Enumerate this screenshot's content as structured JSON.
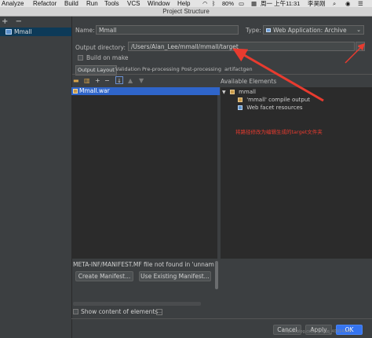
{
  "menubar": {
    "items": [
      "Analyze",
      "Refactor",
      "Build",
      "Run",
      "Tools",
      "VCS",
      "Window",
      "Help"
    ],
    "battery": "80%",
    "clock": "周一 上午11:31",
    "user": "李昊刚"
  },
  "window": {
    "title": "Project Structure"
  },
  "left_pane": {
    "add_symbol": "+",
    "remove_symbol": "−",
    "items": [
      {
        "label": "Mmall",
        "selected": true
      }
    ]
  },
  "form": {
    "name_label": "Name:",
    "name_value": "Mmall",
    "type_label": "Type:",
    "type_value": "Web Application: Archive",
    "output_dir_label": "Output directory:",
    "output_dir_value": "/Users/Alan_Lee/mmall/mmall/target",
    "build_on_make_label": "Build on make",
    "build_on_make_checked": false
  },
  "tabs": [
    {
      "label": "Output Layout",
      "active": true
    },
    {
      "label": "Validation",
      "active": false
    },
    {
      "label": "Pre-processing",
      "active": false
    },
    {
      "label": "Post-processing",
      "active": false
    },
    {
      "label": "artifactgen",
      "active": false
    }
  ],
  "output_layout": {
    "toolbar_icons": [
      "folder-icon",
      "archive-icon",
      "add-icon",
      "remove-icon",
      "sort-icon",
      "move-up-icon",
      "move-down-icon"
    ],
    "root_label": "Mmall.war"
  },
  "available_elements": {
    "title": "Available Elements",
    "items": [
      {
        "label": "mmall",
        "level": 0,
        "expanded": true,
        "icon": "module-folder-icon"
      },
      {
        "label": "'mmall' compile output",
        "level": 1,
        "icon": "compile-output-icon"
      },
      {
        "label": "Web facet resources",
        "level": 1,
        "icon": "web-facet-icon"
      }
    ]
  },
  "annotation": {
    "text": "将路径修改为编辑生成的target文件夹",
    "color": "#e83b2f"
  },
  "manifest": {
    "message": "META-INF/MANIFEST.MF file not found in 'unnamed",
    "create_label": "Create Manifest...",
    "use_existing_label": "Use Existing Manifest..."
  },
  "show_content": {
    "label": "Show content of elements",
    "checked": false
  },
  "buttons": {
    "cancel": "Cancel",
    "apply": "Apply",
    "ok": "OK"
  },
  "watermark": "https://blog.csdn.net/qq_40914148",
  "colors": {
    "selection": "#2f65ca",
    "background": "#3c3f41",
    "list_bg": "#2b2b2b",
    "arrow": "#e83b2f",
    "ok_button": "#3574f0"
  }
}
